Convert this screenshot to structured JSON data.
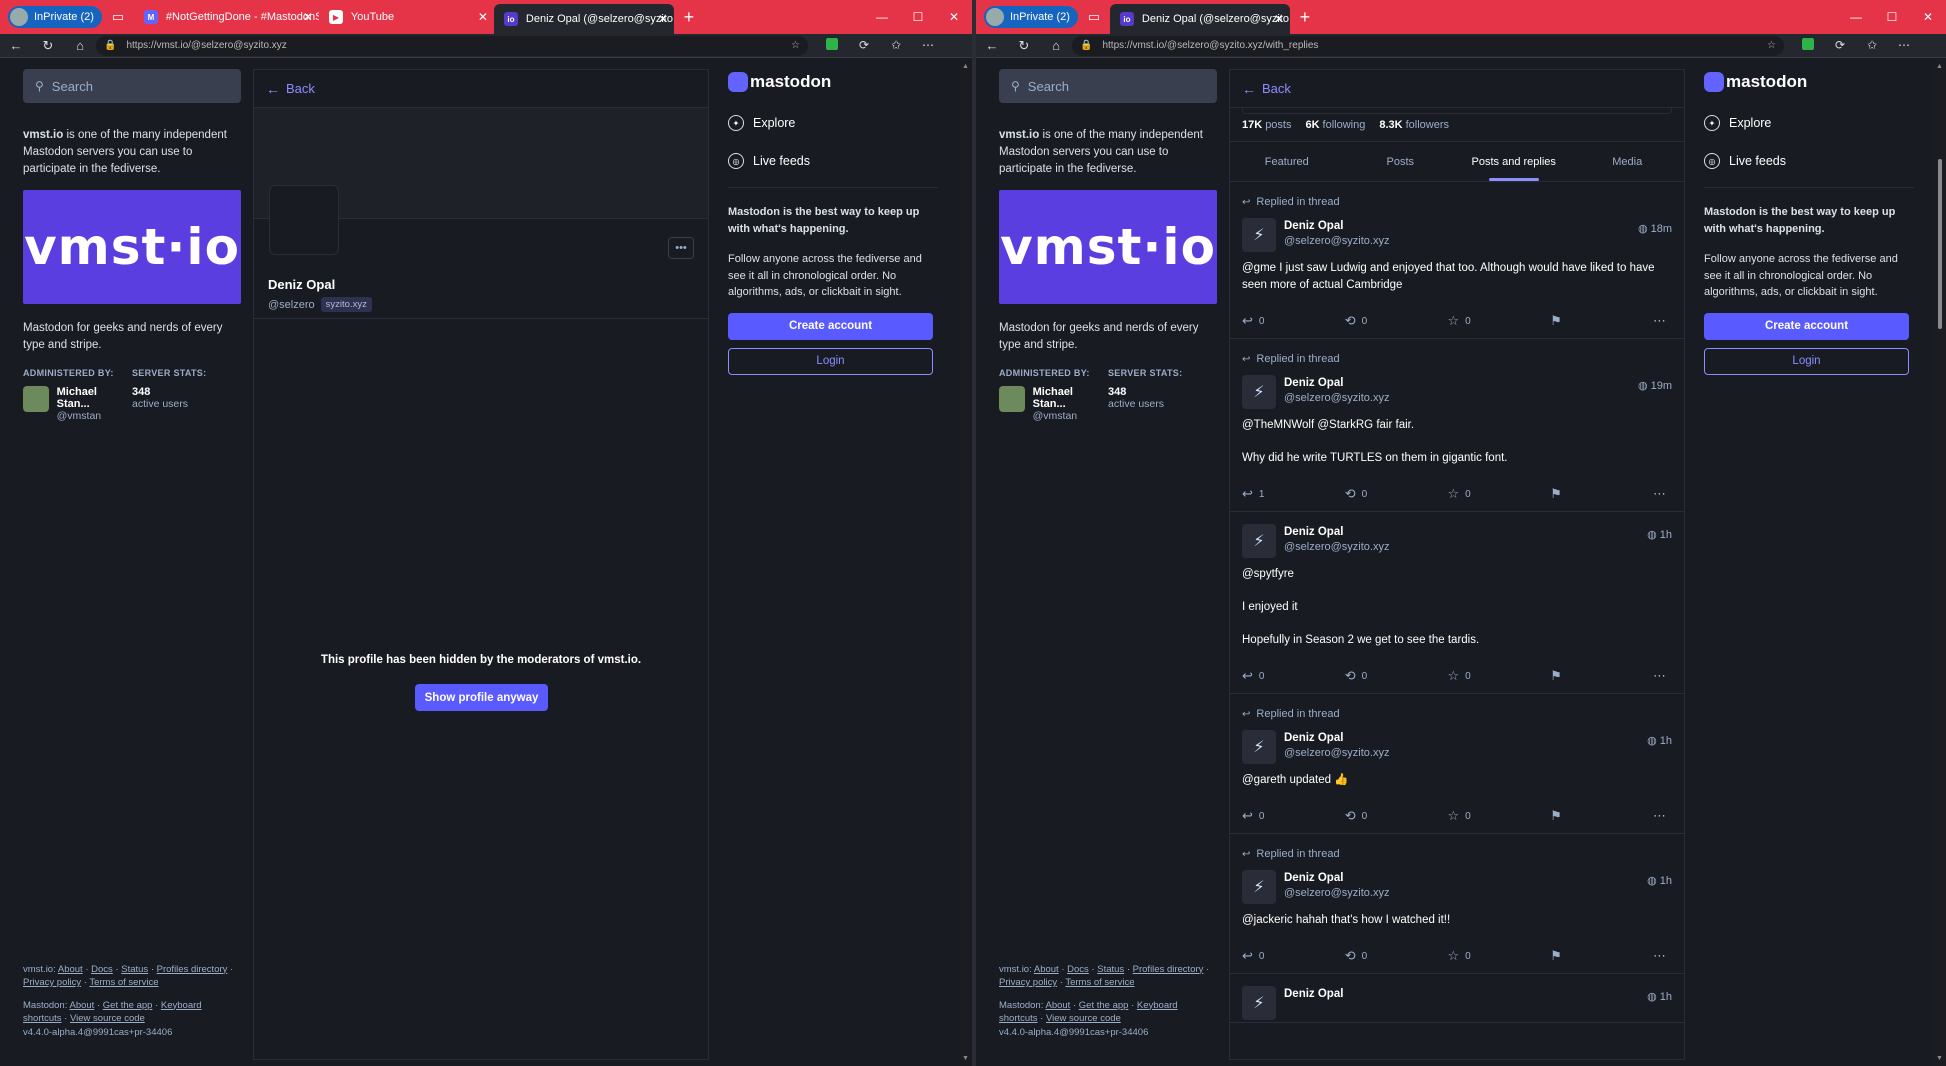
{
  "left_window": {
    "tabs": [
      {
        "title": "InPrivate (2)"
      },
      {
        "title": "#NotGettingDone - #MastodonS"
      },
      {
        "title": "YouTube"
      },
      {
        "title": "Deniz Opal (@selzero@syzito.xyz"
      }
    ],
    "url_host": "https://vmst.io",
    "url_path": "/@selzero@syzito.xyz",
    "profile": {
      "name": "Deniz Opal",
      "handle": "@selzero",
      "domain": "syzito.xyz",
      "hidden_message": "This profile has been hidden by the moderators of vmst.io.",
      "show_button": "Show profile anyway"
    }
  },
  "right_window": {
    "tabs": [
      {
        "title": "InPrivate (2)"
      },
      {
        "title": "Deniz Opal (@selzero@syzito.xyz"
      }
    ],
    "url_host": "https://vmst.io",
    "url_path": "/@selzero@syzito.xyz/with_replies",
    "stats": {
      "posts": "17K",
      "posts_label": "posts",
      "following": "6K",
      "following_label": "following",
      "followers": "8.3K",
      "followers_label": "followers"
    },
    "profile_tabs": [
      "Featured",
      "Posts",
      "Posts and replies",
      "Media"
    ],
    "active_tab": "Posts and replies",
    "posts": [
      {
        "reply_label": "Replied in thread",
        "author": "Deniz Opal",
        "handle": "@selzero@syzito.xyz",
        "time": "18m",
        "body": [
          "@gme I just saw Ludwig and enjoyed that too. Although would have liked to have seen more of actual Cambridge"
        ],
        "replies": "0",
        "boosts": "0",
        "favs": "0"
      },
      {
        "reply_label": "Replied in thread",
        "author": "Deniz Opal",
        "handle": "@selzero@syzito.xyz",
        "time": "19m",
        "body": [
          "@TheMNWolf @StarkRG fair fair.",
          "Why did he write TURTLES on them in gigantic font."
        ],
        "replies": "1",
        "boosts": "0",
        "favs": "0"
      },
      {
        "reply_label": "",
        "author": "Deniz Opal",
        "handle": "@selzero@syzito.xyz",
        "time": "1h",
        "body": [
          "@spytfyre",
          "I enjoyed it",
          "Hopefully in Season 2 we get to see the tardis."
        ],
        "replies": "0",
        "boosts": "0",
        "favs": "0"
      },
      {
        "reply_label": "Replied in thread",
        "author": "Deniz Opal",
        "handle": "@selzero@syzito.xyz",
        "time": "1h",
        "body": [
          "@gareth  updated 👍"
        ],
        "replies": "0",
        "boosts": "0",
        "favs": "0"
      },
      {
        "reply_label": "Replied in thread",
        "author": "Deniz Opal",
        "handle": "@selzero@syzito.xyz",
        "time": "1h",
        "body": [
          "@jackeric hahah that's how I watched it!!"
        ],
        "replies": "0",
        "boosts": "0",
        "favs": "0"
      },
      {
        "reply_label": "",
        "author": "Deniz Opal",
        "handle": "",
        "time": "1h",
        "body": [],
        "replies": "",
        "boosts": "",
        "favs": ""
      }
    ]
  },
  "common": {
    "search_placeholder": "Search",
    "back_label": "Back",
    "server_about_bold": "vmst.io",
    "server_about_rest": " is one of the many independent Mastodon servers you can use to participate in the fediverse.",
    "banner_text": "vmst·io",
    "server_desc": "Mastodon for geeks and nerds of every type and stripe.",
    "administered_by_label": "ADMINISTERED BY:",
    "server_stats_label": "SERVER STATS:",
    "admin_name": "Michael Stan...",
    "admin_handle": "@vmstan",
    "active_users_count": "348",
    "active_users_label": "active users",
    "logo_text": "mastodon",
    "explore": "Explore",
    "live_feeds": "Live feeds",
    "pitch_bold": "Mastodon is the best way to keep up with what's happening.",
    "pitch": "Follow anyone across the fediverse and see it all in chronological order. No algorithms, ads, or clickbait in sight.",
    "create_account": "Create account",
    "login": "Login",
    "footer1_prefix": "vmst.io:",
    "footer1_links": [
      "About",
      "Docs",
      "Status",
      "Profiles directory",
      "Privacy policy",
      "Terms of service"
    ],
    "footer2_prefix": "Mastodon:",
    "footer2_links": [
      "About",
      "Get the app",
      "Keyboard shortcuts",
      "View source code"
    ],
    "version": "v4.4.0-alpha.4@9991cas+pr-34406"
  },
  "colors": {
    "tabbar": "#e53348",
    "accent": "#595aff",
    "link": "#8c8dff",
    "bg": "#191b22"
  }
}
